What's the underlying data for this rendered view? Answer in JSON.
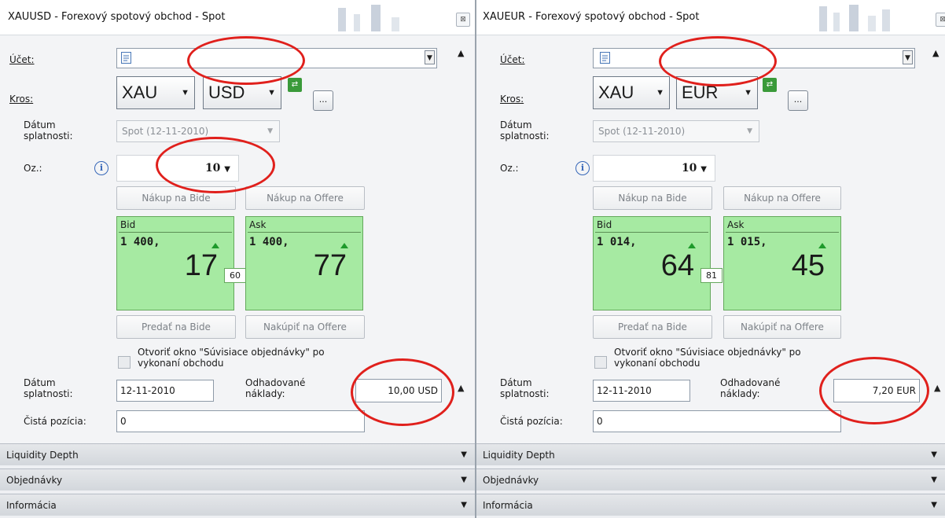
{
  "panels": [
    {
      "title": "XAUUSD - Forexový spotový obchod - Spot",
      "account_label": "Účet:",
      "cross_label": "Kros:",
      "base": "XAU",
      "quote": "USD",
      "dots": "...",
      "settle_label_1": "Dátum",
      "settle_label_2": "splatnosti:",
      "settle_value": "Spot (12-11-2010)",
      "qty_label": "Oz.:",
      "qty_value": "10",
      "buy_bid": "Nákup na Bide",
      "buy_offer": "Nákup na Offere",
      "bid_label": "Bid",
      "bid_big": "1 400,",
      "bid_pips": "17",
      "ask_label": "Ask",
      "ask_big": "1 400,",
      "ask_pips": "77",
      "spread": "60",
      "sell_bid": "Predať na Bide",
      "buy_at_offer": "Nakúpiť na Offere",
      "checkbox_text_1": "Otvoriť okno \"Súvisiace objednávky\" po",
      "checkbox_text_2": "vykonaní obchodu",
      "date_label_1": "Dátum",
      "date_label_2": "splatnosti:",
      "date_value": "12-11-2010",
      "cost_label_1": "Odhadované",
      "cost_label_2": "náklady:",
      "cost_value": "10,00 USD",
      "net_label": "Čistá pozícia:",
      "net_value": "0",
      "sections": [
        "Liquidity Depth",
        "Objednávky",
        "Informácia"
      ]
    },
    {
      "title": "XAUEUR - Forexový spotový obchod - Spot",
      "account_label": "Účet:",
      "cross_label": "Kros:",
      "base": "XAU",
      "quote": "EUR",
      "dots": "...",
      "settle_label_1": "Dátum",
      "settle_label_2": "splatnosti:",
      "settle_value": "Spot (12-11-2010)",
      "qty_label": "Oz.:",
      "qty_value": "10",
      "buy_bid": "Nákup na Bide",
      "buy_offer": "Nákup na Offere",
      "bid_label": "Bid",
      "bid_big": "1 014,",
      "bid_pips": "64",
      "ask_label": "Ask",
      "ask_big": "1 015,",
      "ask_pips": "45",
      "spread": "81",
      "sell_bid": "Predať na Bide",
      "buy_at_offer": "Nakúpiť na Offere",
      "checkbox_text_1": "Otvoriť okno \"Súvisiace objednávky\" po",
      "checkbox_text_2": "vykonaní obchodu",
      "date_label_1": "Dátum",
      "date_label_2": "splatnosti:",
      "date_value": "12-11-2010",
      "cost_label_1": "Odhadované",
      "cost_label_2": "náklady:",
      "cost_value": "7,20 EUR",
      "net_label": "Čistá pozícia:",
      "net_value": "0",
      "sections": [
        "Liquidity Depth",
        "Objednávky",
        "Informácia"
      ]
    }
  ],
  "colors": {
    "highlight_ring": "#e0201c",
    "price_tile": "#a6eaa2",
    "up_arrow": "#1e9a2b"
  }
}
